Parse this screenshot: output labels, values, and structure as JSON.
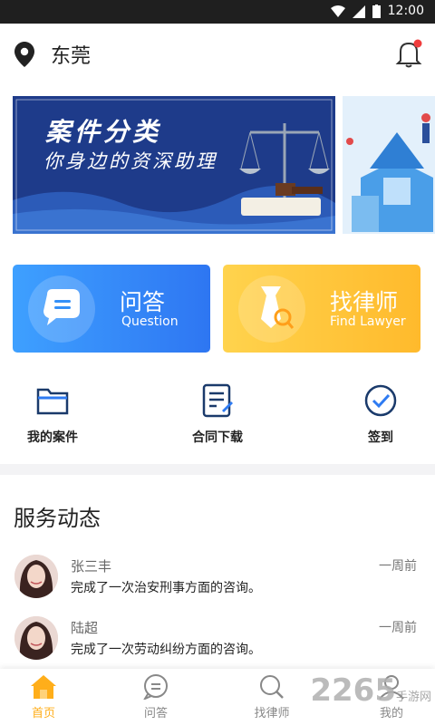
{
  "status_bar": {
    "time": "12:00"
  },
  "header": {
    "city": "东莞"
  },
  "banner": {
    "title": "案件分类",
    "subtitle": "你身边的资深助理"
  },
  "cards": [
    {
      "cn": "问答",
      "en": "Question"
    },
    {
      "cn": "找律师",
      "en": "Find Lawyer"
    }
  ],
  "quick_actions": [
    {
      "label": "我的案件",
      "icon": "folder-icon"
    },
    {
      "label": "合同下载",
      "icon": "document-icon"
    },
    {
      "label": "签到",
      "icon": "check-circle-icon"
    }
  ],
  "service": {
    "title": "服务动态",
    "items": [
      {
        "name": "张三丰",
        "time": "一周前",
        "desc": "完成了一次治安刑事方面的咨询。"
      },
      {
        "name": "陆超",
        "time": "一周前",
        "desc": "完成了一次劳动纠纷方面的咨询。"
      }
    ]
  },
  "tabbar": {
    "tabs": [
      {
        "label": "首页",
        "icon": "home-icon",
        "active": true
      },
      {
        "label": "问答",
        "icon": "chat-icon",
        "active": false
      },
      {
        "label": "找律师",
        "icon": "search-icon",
        "active": false
      },
      {
        "label": "我的",
        "icon": "user-icon",
        "active": false
      }
    ]
  },
  "watermark": {
    "brand": "2265",
    "sub": "手游网"
  },
  "colors": {
    "accent": "#ffae1a",
    "blue_card": "#2e76f2",
    "yellow_card": "#ffba2c",
    "banner_bg": "#1e3b8a"
  }
}
